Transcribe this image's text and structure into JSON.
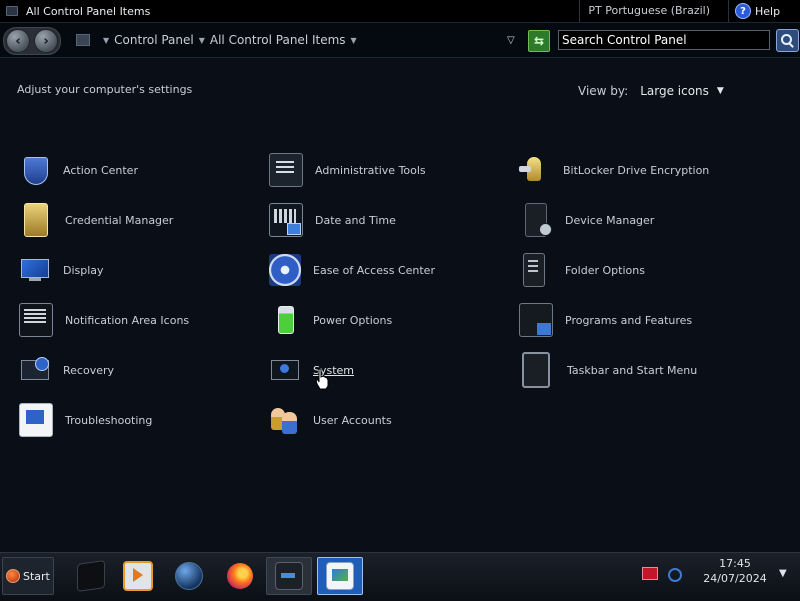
{
  "window": {
    "title": "All Control Panel Items",
    "language": "PT Portuguese (Brazil)",
    "help_label": "Help"
  },
  "nav": {
    "breadcrumbs": [
      "Control Panel",
      "All Control Panel Items"
    ],
    "search_placeholder": "Search Control Panel"
  },
  "content": {
    "subtitle": "Adjust your computer's settings",
    "view_by_label": "View by:",
    "view_by_value": "Large icons",
    "items": [
      {
        "label": "Action Center",
        "icon": "action-center-icon"
      },
      {
        "label": "Administrative Tools",
        "icon": "administrative-tools-icon"
      },
      {
        "label": "BitLocker Drive Encryption",
        "icon": "bitlocker-icon"
      },
      {
        "label": "Credential Manager",
        "icon": "credential-manager-icon"
      },
      {
        "label": "Date and Time",
        "icon": "date-time-icon"
      },
      {
        "label": "Device Manager",
        "icon": "device-manager-icon"
      },
      {
        "label": "Display",
        "icon": "display-icon"
      },
      {
        "label": "Ease of Access Center",
        "icon": "ease-of-access-icon"
      },
      {
        "label": "Folder Options",
        "icon": "folder-options-icon"
      },
      {
        "label": "Notification Area Icons",
        "icon": "notification-area-icon"
      },
      {
        "label": "Power Options",
        "icon": "power-options-icon"
      },
      {
        "label": "Programs and Features",
        "icon": "programs-features-icon"
      },
      {
        "label": "Recovery",
        "icon": "recovery-icon"
      },
      {
        "label": "System",
        "icon": "system-icon"
      },
      {
        "label": "Taskbar and Start Menu",
        "icon": "taskbar-start-menu-icon"
      },
      {
        "label": "Troubleshooting",
        "icon": "troubleshooting-icon"
      },
      {
        "label": "User Accounts",
        "icon": "user-accounts-icon"
      }
    ]
  },
  "taskbar": {
    "start_label": "Start",
    "time": "17:45",
    "date": "24/07/2024"
  }
}
